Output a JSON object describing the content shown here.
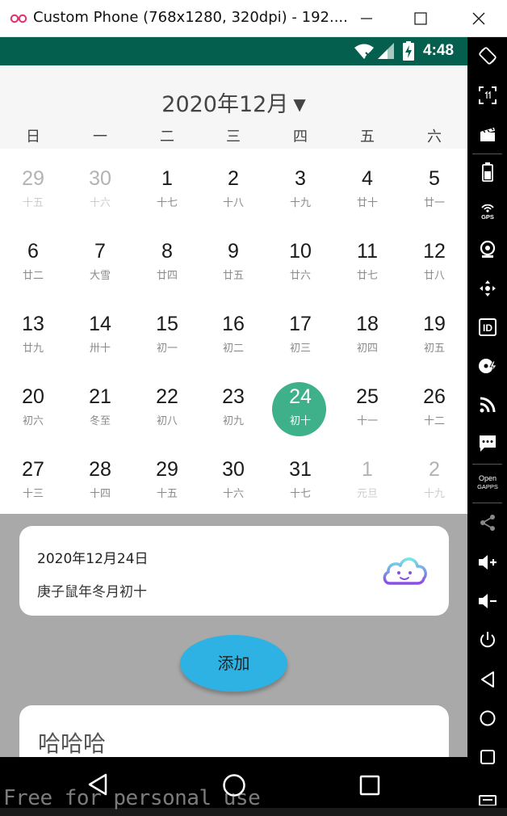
{
  "window": {
    "title": "Custom Phone (768x1280, 320dpi) - 192...."
  },
  "status_bar": {
    "time": "4:48"
  },
  "calendar": {
    "month_title": "2020年12月",
    "dropdown_arrow": "▼",
    "weekdays": [
      "日",
      "一",
      "二",
      "三",
      "四",
      "五",
      "六"
    ],
    "weeks": [
      [
        {
          "day": "29",
          "lunar": "十五",
          "other": true
        },
        {
          "day": "30",
          "lunar": "十六",
          "other": true
        },
        {
          "day": "1",
          "lunar": "十七"
        },
        {
          "day": "2",
          "lunar": "十八"
        },
        {
          "day": "3",
          "lunar": "十九"
        },
        {
          "day": "4",
          "lunar": "廿十"
        },
        {
          "day": "5",
          "lunar": "廿一"
        }
      ],
      [
        {
          "day": "6",
          "lunar": "廿二"
        },
        {
          "day": "7",
          "lunar": "大雪"
        },
        {
          "day": "8",
          "lunar": "廿四"
        },
        {
          "day": "9",
          "lunar": "廿五"
        },
        {
          "day": "10",
          "lunar": "廿六"
        },
        {
          "day": "11",
          "lunar": "廿七"
        },
        {
          "day": "12",
          "lunar": "廿八"
        }
      ],
      [
        {
          "day": "13",
          "lunar": "廿九"
        },
        {
          "day": "14",
          "lunar": "卅十"
        },
        {
          "day": "15",
          "lunar": "初一"
        },
        {
          "day": "16",
          "lunar": "初二"
        },
        {
          "day": "17",
          "lunar": "初三"
        },
        {
          "day": "18",
          "lunar": "初四"
        },
        {
          "day": "19",
          "lunar": "初五"
        }
      ],
      [
        {
          "day": "20",
          "lunar": "初六"
        },
        {
          "day": "21",
          "lunar": "冬至"
        },
        {
          "day": "22",
          "lunar": "初八"
        },
        {
          "day": "23",
          "lunar": "初九"
        },
        {
          "day": "24",
          "lunar": "初十",
          "selected": true
        },
        {
          "day": "25",
          "lunar": "十一"
        },
        {
          "day": "26",
          "lunar": "十二"
        }
      ],
      [
        {
          "day": "27",
          "lunar": "十三"
        },
        {
          "day": "28",
          "lunar": "十四"
        },
        {
          "day": "29",
          "lunar": "十五"
        },
        {
          "day": "30",
          "lunar": "十六"
        },
        {
          "day": "31",
          "lunar": "十七"
        },
        {
          "day": "1",
          "lunar": "元旦",
          "other": true
        },
        {
          "day": "2",
          "lunar": "十九",
          "other": true
        }
      ]
    ],
    "selected_color": "#3fb18a"
  },
  "info_card": {
    "date": "2020年12月24日",
    "lunar_date": "庚子鼠年冬月初十",
    "icon": "cloud-face-icon"
  },
  "add_button": {
    "label": "添加",
    "color": "#2eb2e4"
  },
  "note_card": {
    "title": "哈哈哈"
  },
  "watermark": "Free for personal use",
  "colors": {
    "status_bar": "#045f4f",
    "lower_panel": "#a9a9a9"
  }
}
